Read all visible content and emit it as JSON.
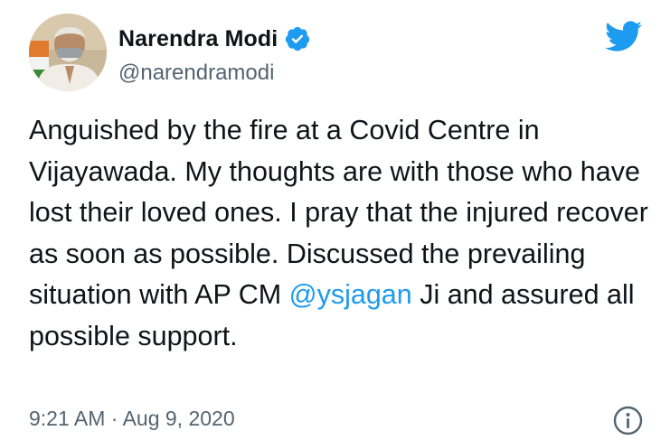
{
  "author": {
    "display_name": "Narendra Modi",
    "handle": "@narendramodi",
    "verified": true
  },
  "tweet": {
    "text_before_mention": "Anguished by the fire at a Covid Centre in Vijayawada. My thoughts are with those who have lost their loved ones. I pray that the injured recover as soon as possible. Discussed the prevailing situation with AP CM ",
    "mention": "@ysjagan",
    "text_after_mention": " Ji and assured all possible support.",
    "time": "9:21 AM",
    "separator": "·",
    "date": "Aug 9, 2020"
  },
  "icons": {
    "brand": "twitter-bird-icon",
    "verified": "verified-badge-icon",
    "info": "info-icon"
  },
  "colors": {
    "twitter_blue": "#1d9bf0",
    "text_primary": "#0f1419",
    "text_secondary": "#536471"
  }
}
